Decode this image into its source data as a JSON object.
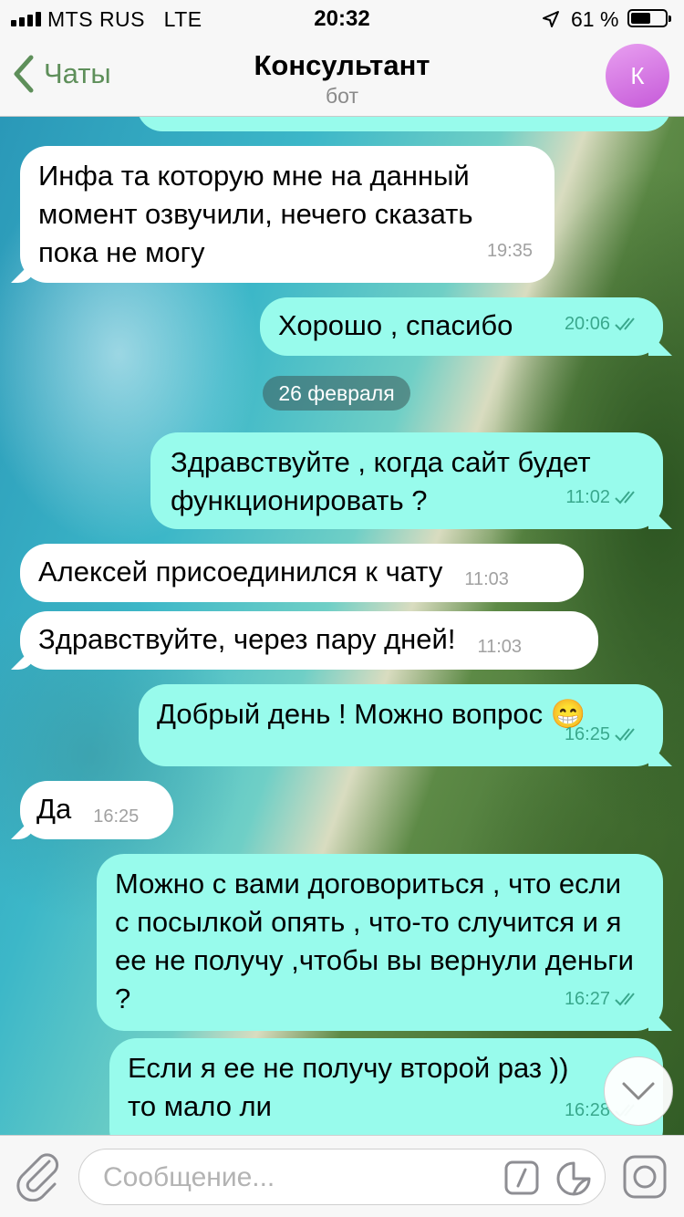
{
  "status_bar": {
    "carrier": "MTS RUS",
    "network": "LTE",
    "time": "20:32",
    "battery_percent": "61 %",
    "battery_level": 0.61,
    "location_icon": "location-arrow-icon"
  },
  "header": {
    "back_label": "Чаты",
    "title": "Консультант",
    "subtitle": "бот",
    "avatar_letter": "К",
    "avatar_color": "#d06ee0"
  },
  "colors": {
    "incoming_bubble": "#ffffff",
    "outgoing_bubble": "#98fbec",
    "outgoing_time": "#3aa88d",
    "incoming_time": "#a1a1a1",
    "accent": "#5e8f5a"
  },
  "messages": [
    {
      "direction": "in",
      "text": "Инфа та которую мне на данный момент озвучили, нечего сказать пока не могу",
      "time": "19:35"
    },
    {
      "direction": "out",
      "text": "Хорошо , спасибо",
      "time": "20:06",
      "read": true
    },
    {
      "type": "date",
      "text": "26 февраля"
    },
    {
      "direction": "out",
      "text": "Здравствуйте , когда сайт будет функционировать ?",
      "time": "11:02",
      "read": true
    },
    {
      "direction": "in",
      "text": "Алексей присоединился к чату",
      "time": "11:03"
    },
    {
      "direction": "in",
      "text": "Здравствуйте, через пару дней!",
      "time": "11:03"
    },
    {
      "direction": "out",
      "text": "Добрый день ! Можно вопрос 😁",
      "time": "16:25",
      "read": true
    },
    {
      "direction": "in",
      "text": "Да",
      "time": "16:25"
    },
    {
      "direction": "out",
      "text": "Можно с вами договориться , что если с посылкой опять , что-то случится и я ее не получу ,чтобы вы вернули деньги ?",
      "time": "16:27",
      "read": true
    },
    {
      "direction": "out",
      "text": "Если я ее не получу второй раз )) то мало ли",
      "time": "16:28",
      "read": true
    }
  ],
  "input": {
    "placeholder": "Сообщение...",
    "value": ""
  }
}
